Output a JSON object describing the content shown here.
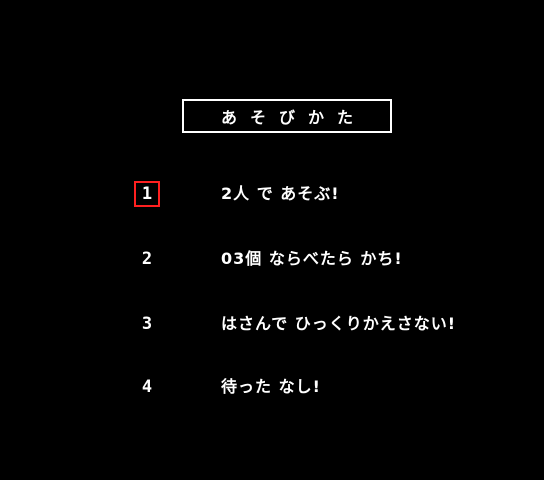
{
  "title": "あそびかた",
  "selected_index": 0,
  "colors": {
    "background": "#000000",
    "text": "#ffffff",
    "cursor": "#ff2020"
  },
  "rules": [
    {
      "number": "1",
      "text": "2人 で あそぶ!"
    },
    {
      "number": "2",
      "text": "03個 ならべたら かち!"
    },
    {
      "number": "3",
      "text": "はさんで ひっくりかえさない!"
    },
    {
      "number": "4",
      "text": "待った なし!"
    }
  ]
}
